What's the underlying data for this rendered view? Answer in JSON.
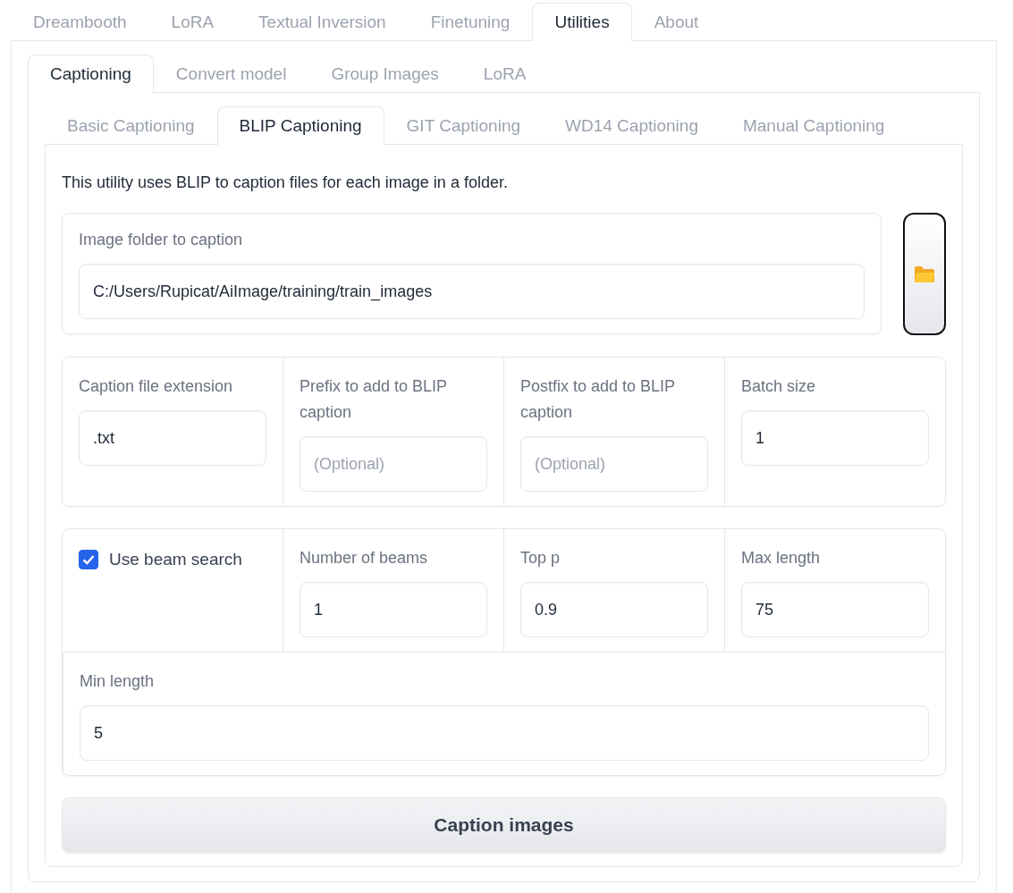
{
  "tabs": [
    {
      "label": "Dreambooth",
      "selected": false
    },
    {
      "label": "LoRA",
      "selected": false
    },
    {
      "label": "Textual Inversion",
      "selected": false
    },
    {
      "label": "Finetuning",
      "selected": false
    },
    {
      "label": "Utilities",
      "selected": true
    },
    {
      "label": "About",
      "selected": false
    }
  ],
  "subtabs": [
    {
      "label": "Captioning",
      "selected": true
    },
    {
      "label": "Convert model",
      "selected": false
    },
    {
      "label": "Group Images",
      "selected": false
    },
    {
      "label": "LoRA",
      "selected": false
    }
  ],
  "caption_tabs": [
    {
      "label": "Basic Captioning",
      "selected": false
    },
    {
      "label": "BLIP Captioning",
      "selected": true
    },
    {
      "label": "GIT Captioning",
      "selected": false
    },
    {
      "label": "WD14 Captioning",
      "selected": false
    },
    {
      "label": "Manual Captioning",
      "selected": false
    }
  ],
  "description": "This utility uses BLIP to caption files for each image in a folder.",
  "image_folder": {
    "label": "Image folder to caption",
    "value": "C:/Users/Rupicat/AiImage/training/train_images"
  },
  "options_row": [
    {
      "label": "Caption file extension",
      "value": ".txt"
    },
    {
      "label": "Prefix to add to BLIP caption",
      "placeholder": "(Optional)"
    },
    {
      "label": "Postfix to add to BLIP caption",
      "placeholder": "(Optional)"
    },
    {
      "label": "Batch size",
      "value": "1"
    }
  ],
  "beam_row": [
    {
      "kind": "checkbox",
      "label": "Use beam search",
      "checked": true
    },
    {
      "kind": "number",
      "label": "Number of beams",
      "value": "1"
    },
    {
      "kind": "number",
      "label": "Top p",
      "value": "0.9"
    },
    {
      "kind": "number",
      "label": "Max length",
      "value": "75"
    }
  ],
  "min_length": {
    "label": "Min length",
    "value": "5"
  },
  "action_button": "Caption images"
}
